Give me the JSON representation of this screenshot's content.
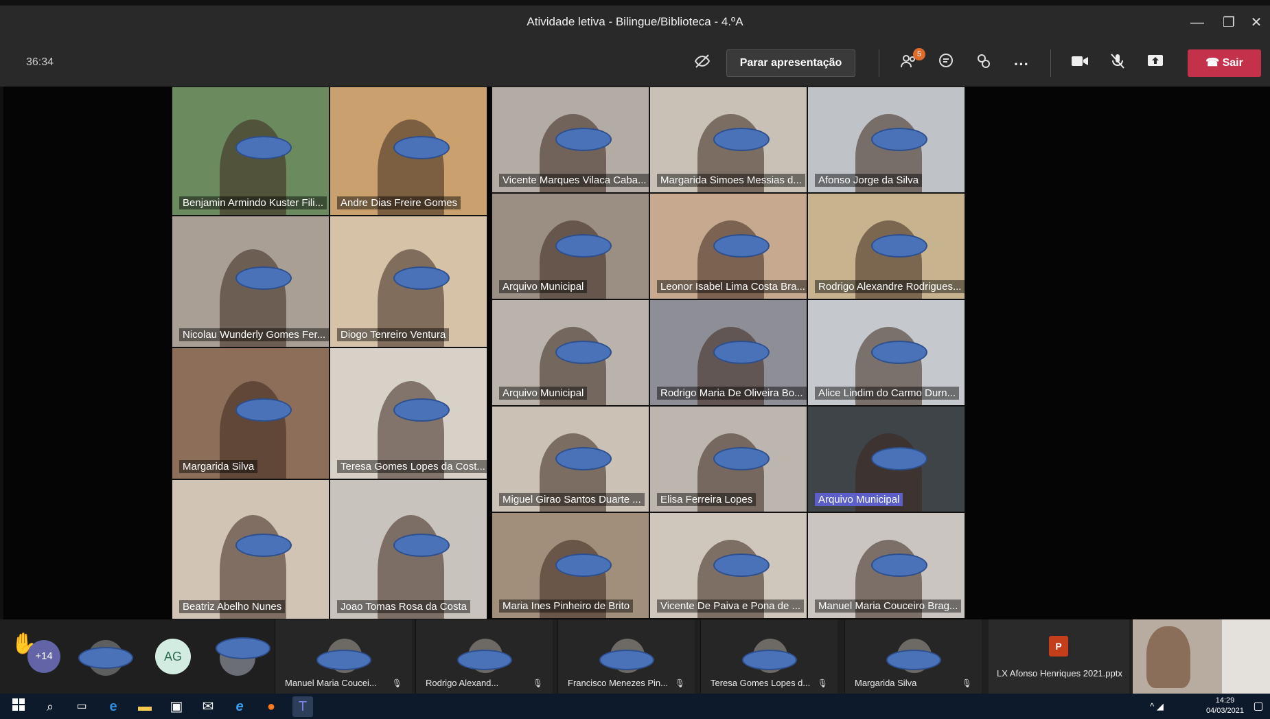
{
  "window": {
    "title": "Atividade letiva - Bilingue/Biblioteca - 4.ºA",
    "minimize_icon": "—",
    "maximize_icon": "❐",
    "close_icon": "✕"
  },
  "toolbar": {
    "timer": "36:34",
    "stop_presenting_label": "Parar apresentação",
    "participants_badge": "5",
    "leave_label": "Sair",
    "more_label": "···"
  },
  "tiles": [
    {
      "name": "Benjamin Armindo Kuster Fili...",
      "bg": "#6b8a5e"
    },
    {
      "name": "Andre Dias Freire Gomes",
      "bg": "#c9a06e"
    },
    {
      "name": "Vicente Marques Vilaca Caba...",
      "bg": "#b3aca4"
    },
    {
      "name": "Margarida Simoes Messias d...",
      "bg": "#c9c1b6"
    },
    {
      "name": "Afonso Jorge da Silva",
      "bg": "#bfc3c8"
    },
    {
      "name": "Arquivo Municipal",
      "bg": "#9b8f83"
    },
    {
      "name": "Nicolau Wunderly Gomes Fer...",
      "bg": "#a99f95"
    },
    {
      "name": "Diogo Tenreiro Ventura",
      "bg": "#d6c2a7"
    },
    {
      "name": "Leonor Isabel Lima Costa Bra...",
      "bg": "#c7a990"
    },
    {
      "name": "Rodrigo Alexandre Rodrigues...",
      "bg": "#c7b48f"
    },
    {
      "name": "Arquivo Municipal",
      "bg": "#b9b3ab"
    },
    {
      "name": "Rodrigo Maria De Oliveira Bo...",
      "bg": "#8e8f96"
    },
    {
      "name": "Alice Lindim do Carmo Durn...",
      "bg": "#c5c9cd"
    },
    {
      "name": "Margarida Silva",
      "bg": "#8d6e58"
    },
    {
      "name": "Teresa Gomes Lopes da Cost...",
      "bg": "#d8d1c7"
    },
    {
      "name": "Miguel Girao Santos Duarte ...",
      "bg": "#cbc1b5"
    },
    {
      "name": "Elisa Ferreira Lopes",
      "bg": "#bdb6ae"
    },
    {
      "name": "Arquivo Municipal",
      "bg": "#3f4449"
    },
    {
      "name": "Beatriz Abelho Nunes",
      "bg": "#d1c4b4"
    },
    {
      "name": "Joao Tomas Rosa da Costa",
      "bg": "#c9c3bd"
    },
    {
      "name": "Maria Ines Pinheiro de Brito",
      "bg": "#a18f7c"
    },
    {
      "name": "Vicente De Paiva e Pona de ...",
      "bg": "#cfc6bc"
    },
    {
      "name": "Manuel Maria Couceiro Brag...",
      "bg": "#cac5c1"
    }
  ],
  "strip": {
    "overflow_count": "+14",
    "initials": "AG",
    "people": [
      {
        "name": "Manuel Maria Coucei..."
      },
      {
        "name": "Rodrigo Alexand..."
      },
      {
        "name": "Francisco Menezes Pin..."
      },
      {
        "name": "Teresa Gomes Lopes d..."
      },
      {
        "name": "Margarida Silva"
      }
    ],
    "file": "LX Afonso Henriques 2021.pptx"
  },
  "taskbar": {
    "time": "14:29",
    "date": "04/03/2021"
  },
  "colors": {
    "leave": "#c4314b",
    "accent": "#5b5fc7",
    "blur_mask": "#4a72b8"
  }
}
